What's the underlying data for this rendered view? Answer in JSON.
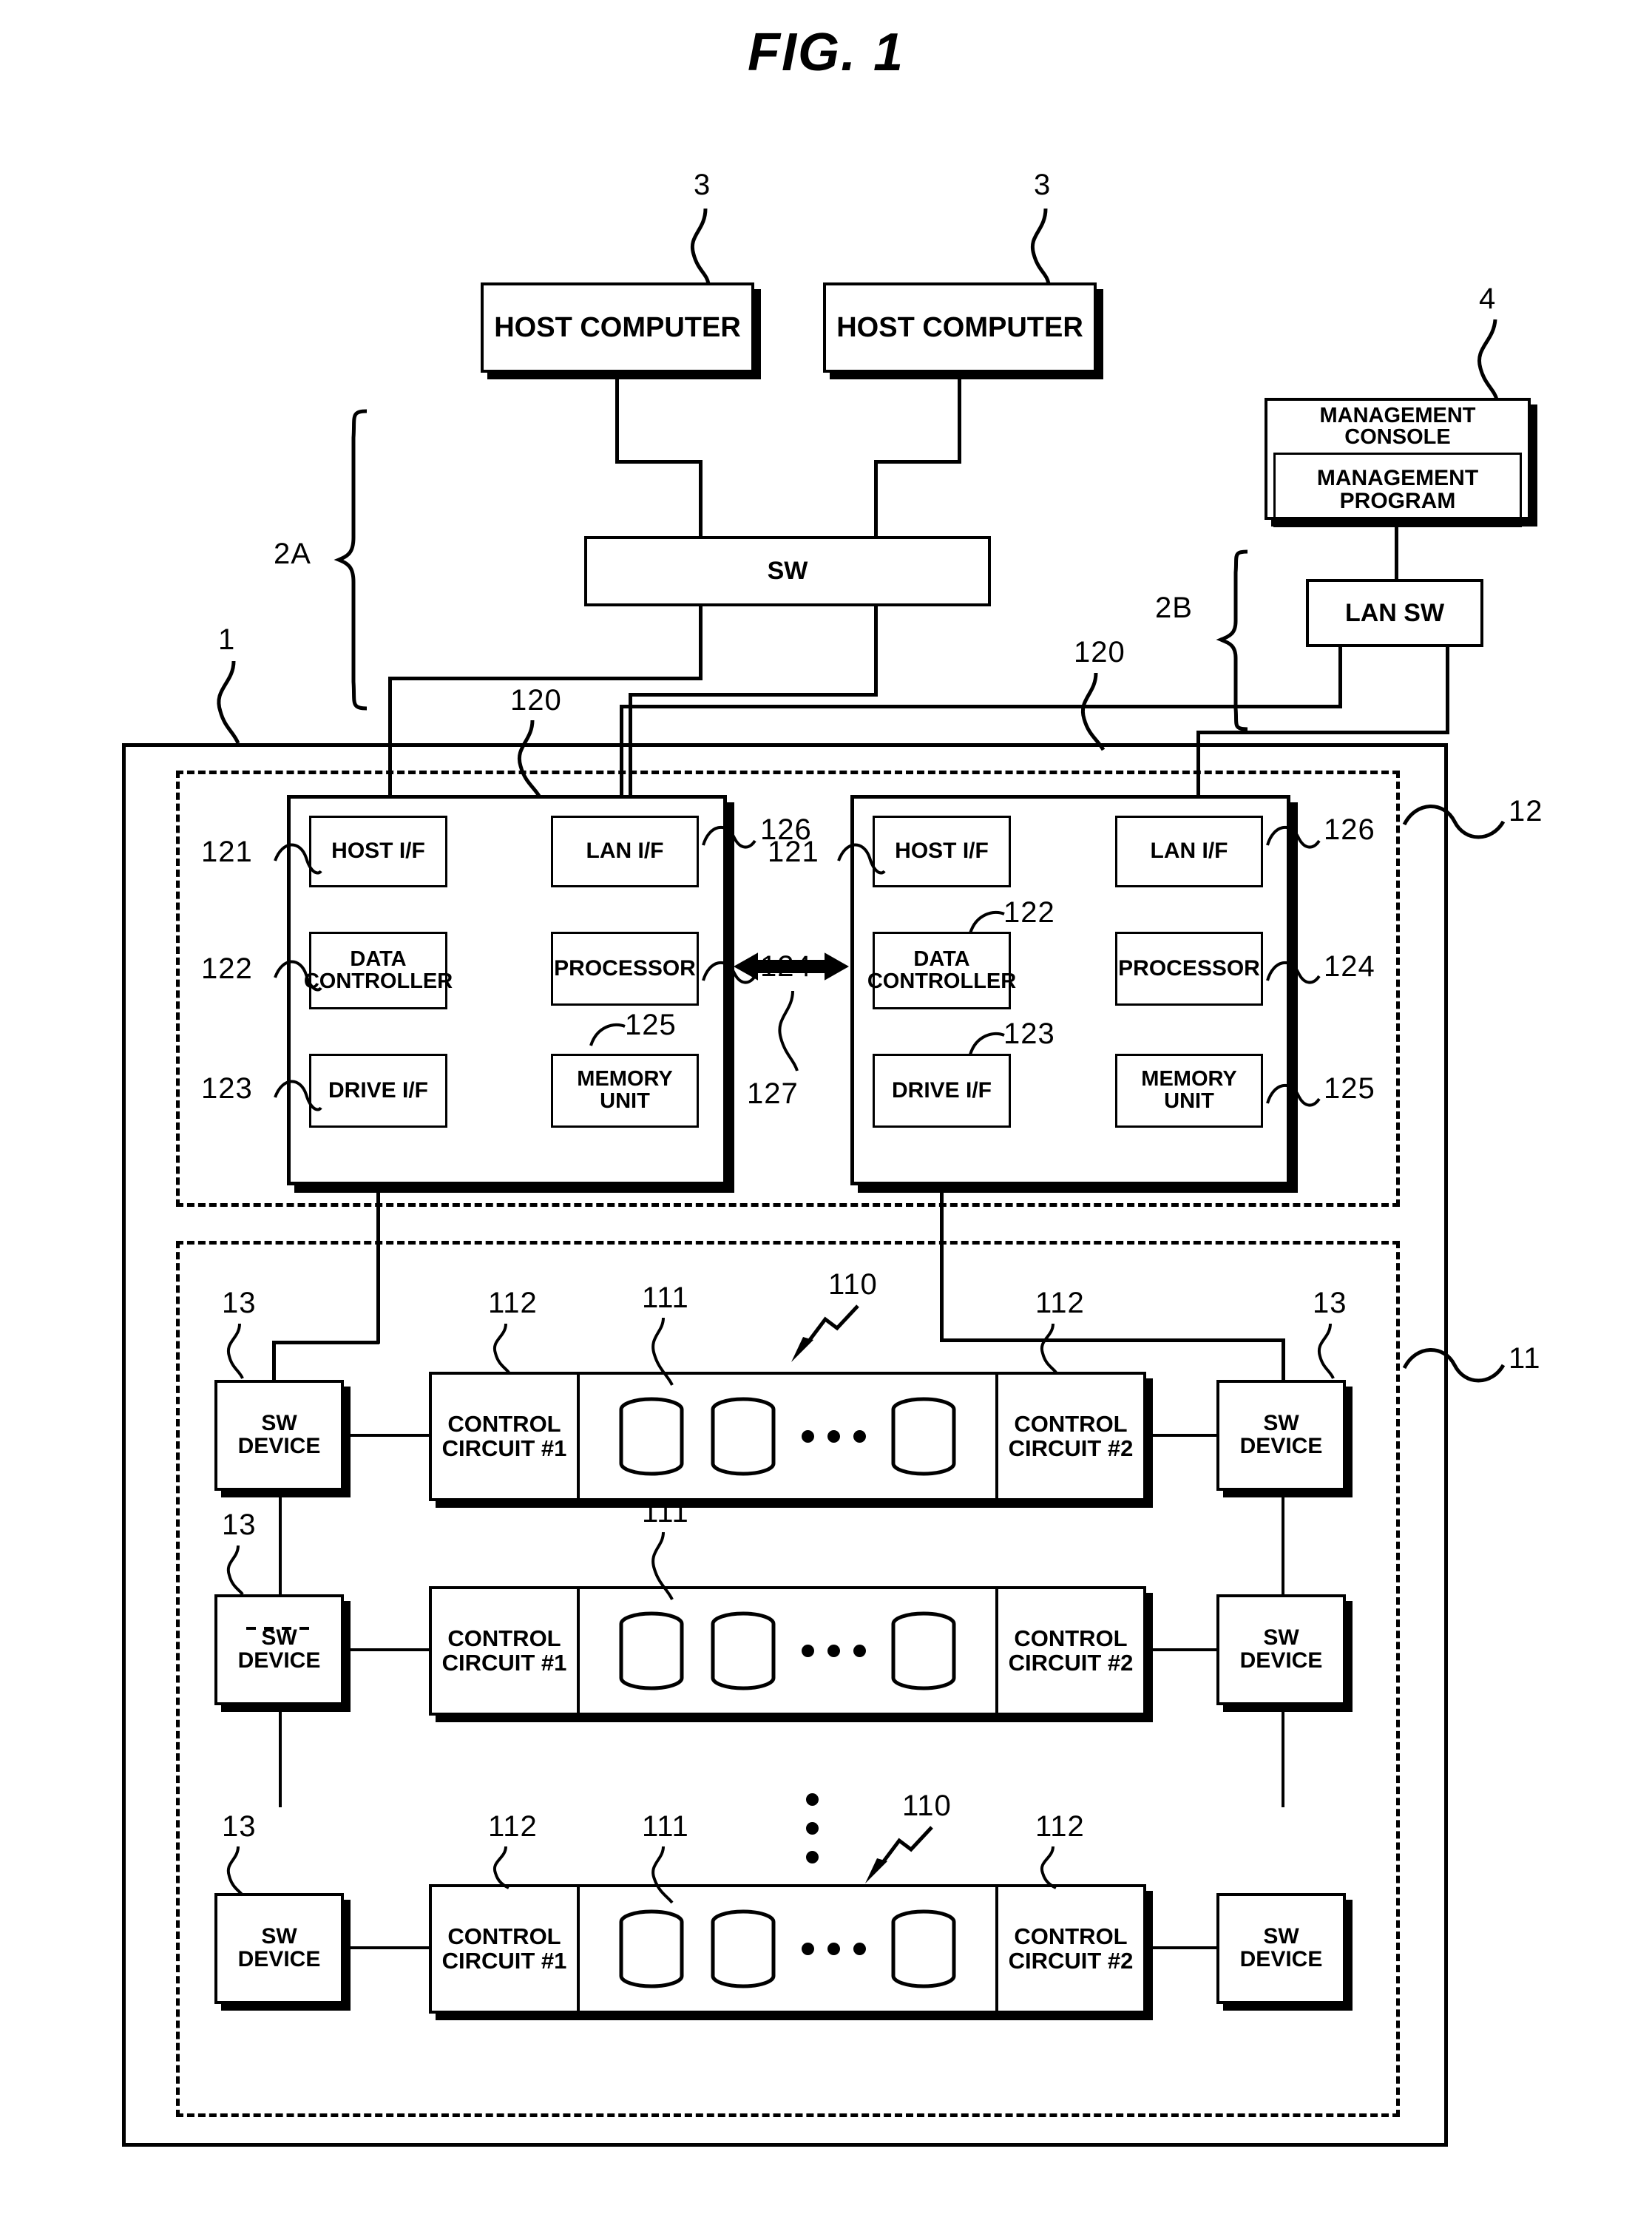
{
  "figure": {
    "title": "FIG. 1"
  },
  "hosts": [
    {
      "label": "HOST COMPUTER",
      "ref": "3"
    },
    {
      "label": "HOST COMPUTER",
      "ref": "3"
    }
  ],
  "fabric_switch": {
    "label": "SW"
  },
  "management": {
    "console_label": "MANAGEMENT CONSOLE",
    "program_label": "MANAGEMENT PROGRAM",
    "ref": "4",
    "lan_switch_label": "LAN SW"
  },
  "network_braces": [
    {
      "label": "2A"
    },
    {
      "label": "2B"
    }
  ],
  "storage_system": {
    "ref": "1",
    "controller_enclosure_ref": "12",
    "drive_enclosure_ref": "11",
    "interconnect_ref": "127",
    "controllers": [
      {
        "ref": "120",
        "blocks": [
          {
            "label": "HOST I/F",
            "ref": "121"
          },
          {
            "label": "LAN I/F",
            "ref": "126"
          },
          {
            "label": "DATA CONTROLLER",
            "ref": "122"
          },
          {
            "label": "PROCESSOR",
            "ref": "124"
          },
          {
            "label": "DRIVE I/F",
            "ref": "123"
          },
          {
            "label": "MEMORY UNIT",
            "ref": "125"
          }
        ]
      },
      {
        "ref": "120",
        "blocks": [
          {
            "label": "HOST I/F",
            "ref": "121"
          },
          {
            "label": "LAN I/F",
            "ref": "126"
          },
          {
            "label": "DATA CONTROLLER",
            "ref": "122"
          },
          {
            "label": "PROCESSOR",
            "ref": "124"
          },
          {
            "label": "DRIVE I/F",
            "ref": "123"
          },
          {
            "label": "MEMORY UNIT",
            "ref": "125"
          }
        ]
      }
    ],
    "drive_rows": [
      {
        "left_switch_label": "SW DEVICE",
        "left_switch_ref": "13",
        "right_switch_label": "SW DEVICE",
        "right_switch_ref": "13",
        "control_circuit_1": "CONTROL CIRCUIT #1",
        "control_circuit_2": "CONTROL CIRCUIT #2",
        "control_circuit_ref_left": "112",
        "control_circuit_ref_right": "112",
        "drive_ref": "111",
        "enclosure_ref": "110"
      },
      {
        "left_switch_label": "SW DEVICE",
        "left_switch_ref": "13",
        "right_switch_label": "SW DEVICE",
        "right_switch_ref": "",
        "control_circuit_1": "CONTROL CIRCUIT #1",
        "control_circuit_2": "CONTROL CIRCUIT #2",
        "control_circuit_ref_left": "",
        "control_circuit_ref_right": "",
        "drive_ref": "111",
        "enclosure_ref": ""
      },
      {
        "left_switch_label": "SW DEVICE",
        "left_switch_ref": "13",
        "right_switch_label": "SW DEVICE",
        "right_switch_ref": "",
        "control_circuit_1": "CONTROL CIRCUIT #1",
        "control_circuit_2": "CONTROL CIRCUIT #2",
        "control_circuit_ref_left": "112",
        "control_circuit_ref_right": "112",
        "drive_ref": "111",
        "enclosure_ref": "110"
      }
    ]
  },
  "colors": {
    "ink": "#000000",
    "paper": "#ffffff"
  }
}
